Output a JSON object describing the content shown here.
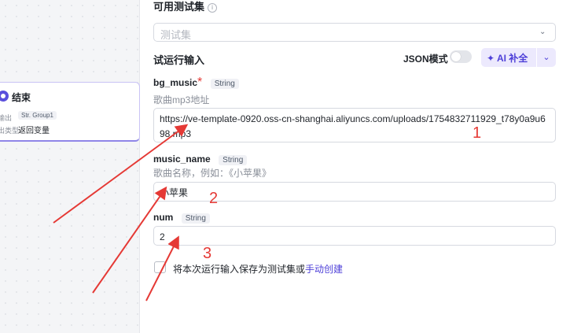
{
  "node": {
    "title": "结束",
    "output_label": "输出",
    "output_tag": "Str. Group1",
    "output_type_label": "出类型",
    "output_value": "返回变量"
  },
  "panel": {
    "available_sets_title": "可用测试集",
    "info_icon": "i",
    "select_placeholder": "测试集",
    "trial_input_title": "试运行输入",
    "json_mode_label": "JSON模式",
    "ai_button_label": "AI 补全",
    "fields": [
      {
        "name": "bg_music",
        "required": "*",
        "type": "String",
        "description": "歌曲mp3地址",
        "value": "https://ve-template-0920.oss-cn-shanghai.aliyuncs.com/uploads/1754832711929_t78y0a9u698.mp3"
      },
      {
        "name": "music_name",
        "type": "String",
        "description": "歌曲名称，例如：《小苹果》",
        "value": "小苹果"
      },
      {
        "name": "num",
        "type": "String",
        "value": "2"
      }
    ],
    "save_text": "将本次运行输入保存为测试集或",
    "save_link": "手动创建"
  },
  "annotations": {
    "color": "#e53935",
    "labels": [
      "1",
      "2",
      "3"
    ]
  },
  "colors": {
    "accent": "#4d3fd8",
    "accent_bg": "#ece9fd",
    "required": "#e53935"
  }
}
